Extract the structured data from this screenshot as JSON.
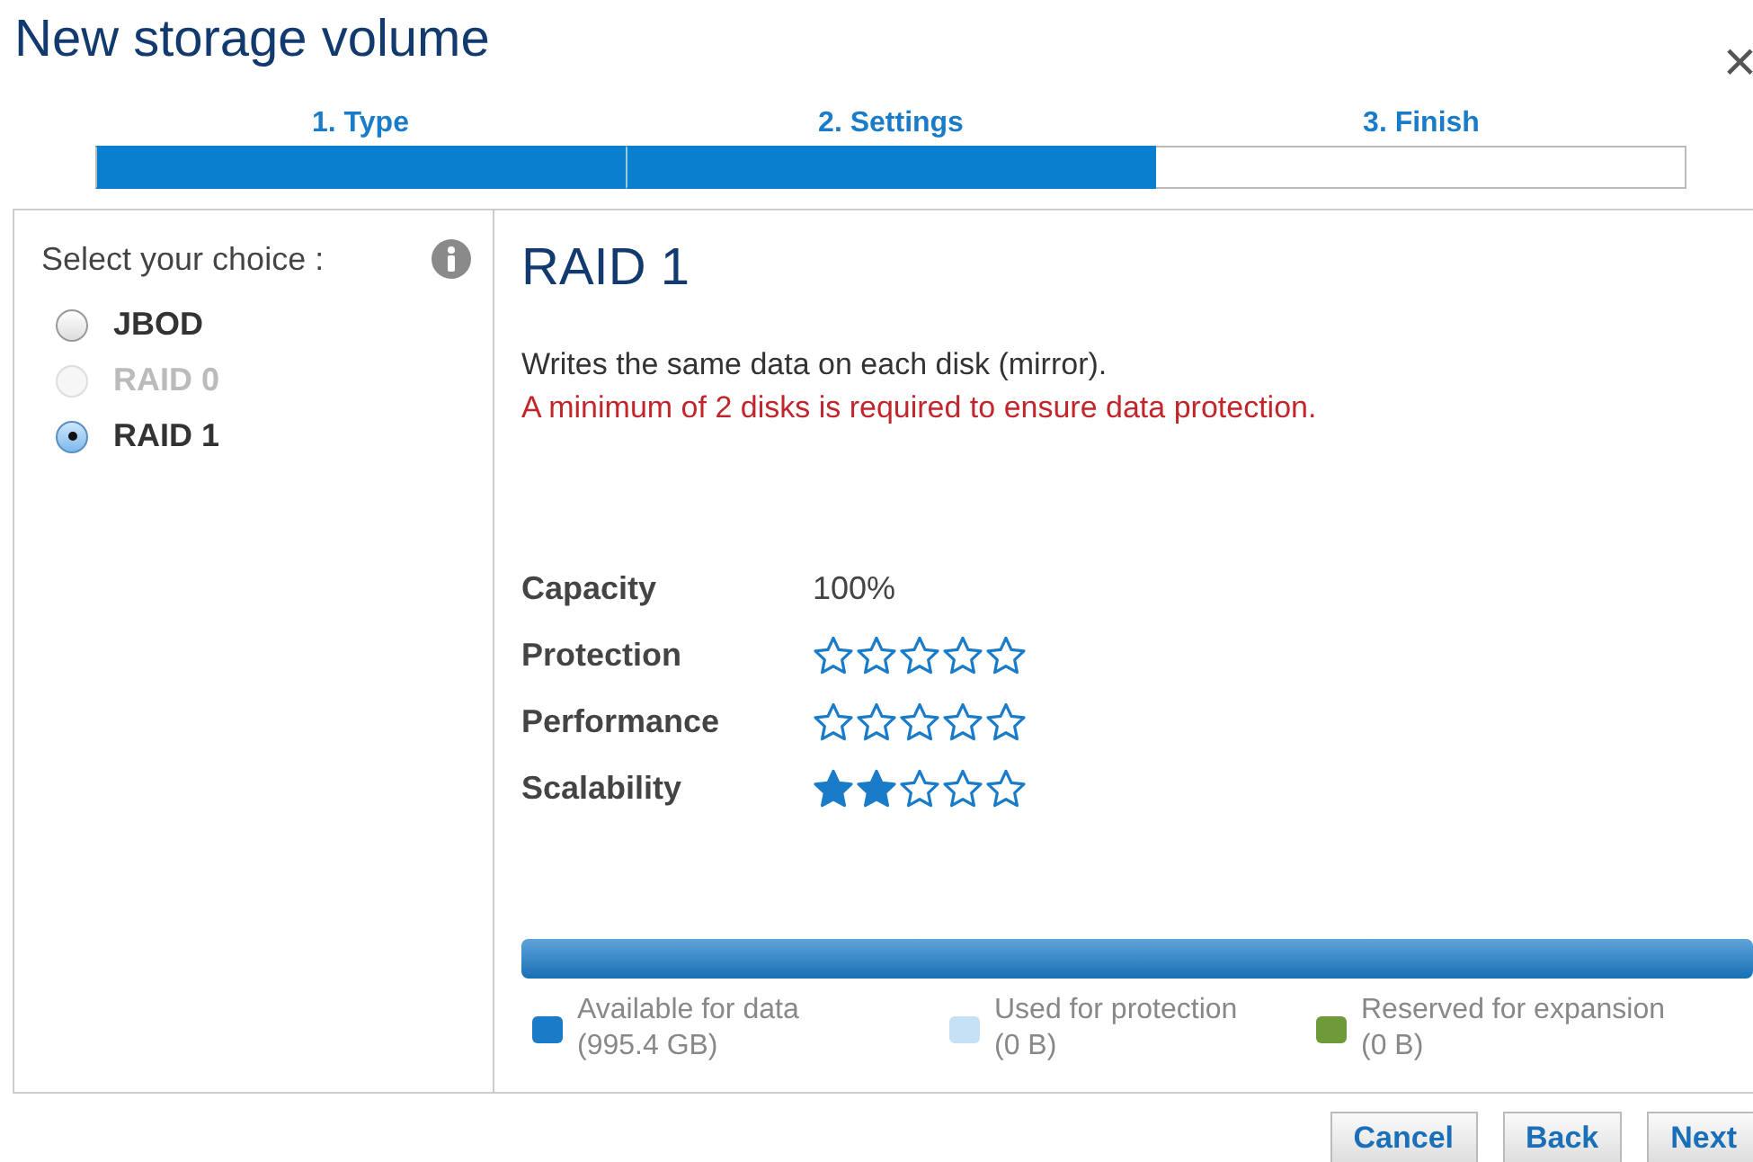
{
  "window": {
    "title": "New storage volume",
    "close": "×"
  },
  "steps": [
    {
      "label": "1. Type",
      "done": true
    },
    {
      "label": "2. Settings",
      "done": true
    },
    {
      "label": "3. Finish",
      "done": false
    }
  ],
  "sidebar": {
    "heading": "Select your choice :",
    "options": [
      {
        "label": "JBOD",
        "selected": false,
        "disabled": false
      },
      {
        "label": "RAID 0",
        "selected": false,
        "disabled": true
      },
      {
        "label": "RAID 1",
        "selected": true,
        "disabled": false
      }
    ]
  },
  "detail": {
    "title": "RAID 1",
    "description": "Writes the same data on each disk (mirror).",
    "warning": "A minimum of 2 disks is required to ensure data protection.",
    "ratings": [
      {
        "kind": "text",
        "label": "Capacity",
        "value": "100%"
      },
      {
        "kind": "stars",
        "label": "Protection",
        "stars": 0
      },
      {
        "kind": "stars",
        "label": "Performance",
        "stars": 0
      },
      {
        "kind": "stars",
        "label": "Scalability",
        "stars": 2
      }
    ],
    "usage": [
      {
        "label": "Available for data",
        "amount": "(995.4 GB)",
        "color": "#1a7cc8",
        "level": 1
      },
      {
        "label": "Used for protection",
        "amount": "(0 B)",
        "color": "#c6e0f5",
        "level": 0
      },
      {
        "label": "Reserved for expansion",
        "amount": "(0 B)",
        "color": "#6f9a3a",
        "level": 0
      }
    ]
  },
  "buttons": [
    "Cancel",
    "Back",
    "Next"
  ]
}
